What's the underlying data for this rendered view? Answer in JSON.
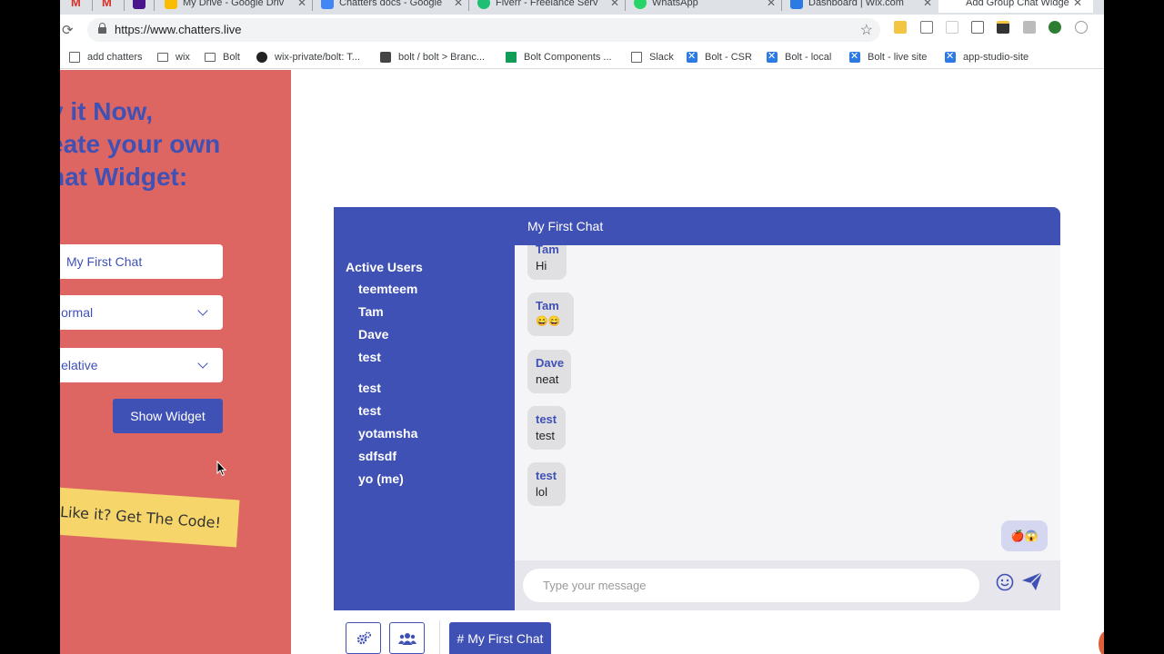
{
  "browser": {
    "tabs": [
      {
        "label": "",
        "icon": "gmail-icon",
        "color": "#d93025"
      },
      {
        "label": "",
        "icon": "gmail-icon",
        "color": "#d93025"
      },
      {
        "label": "",
        "icon": "app-icon",
        "color": "#4a148c"
      },
      {
        "label": "My Drive - Google Driv",
        "icon": "drive-icon",
        "color": "#fbbc04"
      },
      {
        "label": "Chatters docs - Google",
        "icon": "docs-icon",
        "color": "#4285f4"
      },
      {
        "label": "Fiverr - Freelance Serv",
        "icon": "fiverr-icon",
        "color": "#1dbf73"
      },
      {
        "label": "WhatsApp",
        "icon": "whatsapp-icon",
        "color": "#25d366"
      },
      {
        "label": "Dashboard | Wix.com",
        "icon": "wix-icon",
        "color": "#2c7be5"
      },
      {
        "label": "Add Group Chat Widge",
        "icon": "none",
        "color": "#ffffff"
      }
    ],
    "url": "https://www.chatters.live",
    "bookmarks": [
      {
        "label": "add chatters",
        "icon": "doc-icon"
      },
      {
        "label": "wix",
        "icon": "folder-icon"
      },
      {
        "label": "Bolt",
        "icon": "folder-icon"
      },
      {
        "label": "wix-private/bolt: T...",
        "icon": "github-icon"
      },
      {
        "label": "bolt / bolt > Branc...",
        "icon": "gitlab-icon"
      },
      {
        "label": "Bolt Components ...",
        "icon": "sheets-icon"
      },
      {
        "label": "Slack",
        "icon": "doc-icon"
      },
      {
        "label": "Bolt - CSR",
        "icon": "wix-icon"
      },
      {
        "label": "Bolt - local",
        "icon": "wix-icon"
      },
      {
        "label": "Bolt - live site",
        "icon": "wix-icon"
      },
      {
        "label": "app-studio-site",
        "icon": "wix-icon"
      }
    ]
  },
  "left_panel": {
    "headline": [
      "y it Now,",
      "eate your own",
      "nat Widget:"
    ],
    "chat_name_value": "My First Chat",
    "size_select": "Normal",
    "position_select": "Relative",
    "show_button": "Show Widget",
    "banner": "Like it? Get The Code!",
    "bg_color": "#dd6662",
    "accent_color": "#3f51b5"
  },
  "chat": {
    "title": "My First Chat",
    "active_users_label": "Active Users",
    "users": [
      "teemteem",
      "Tam",
      "Dave",
      "test",
      "test",
      "test",
      "yotamsha",
      "sdfsdf",
      "yo (me)"
    ],
    "messages": [
      {
        "from": "Tam",
        "text": "Hi"
      },
      {
        "from": "Tam",
        "text": "😄😄"
      },
      {
        "from": "Dave",
        "text": "neat"
      },
      {
        "from": "test",
        "text": "test"
      },
      {
        "from": "test",
        "text": "lol"
      }
    ],
    "my_message": "🍎😱",
    "input_placeholder": "Type your message",
    "tab_label": "# My First Chat"
  }
}
